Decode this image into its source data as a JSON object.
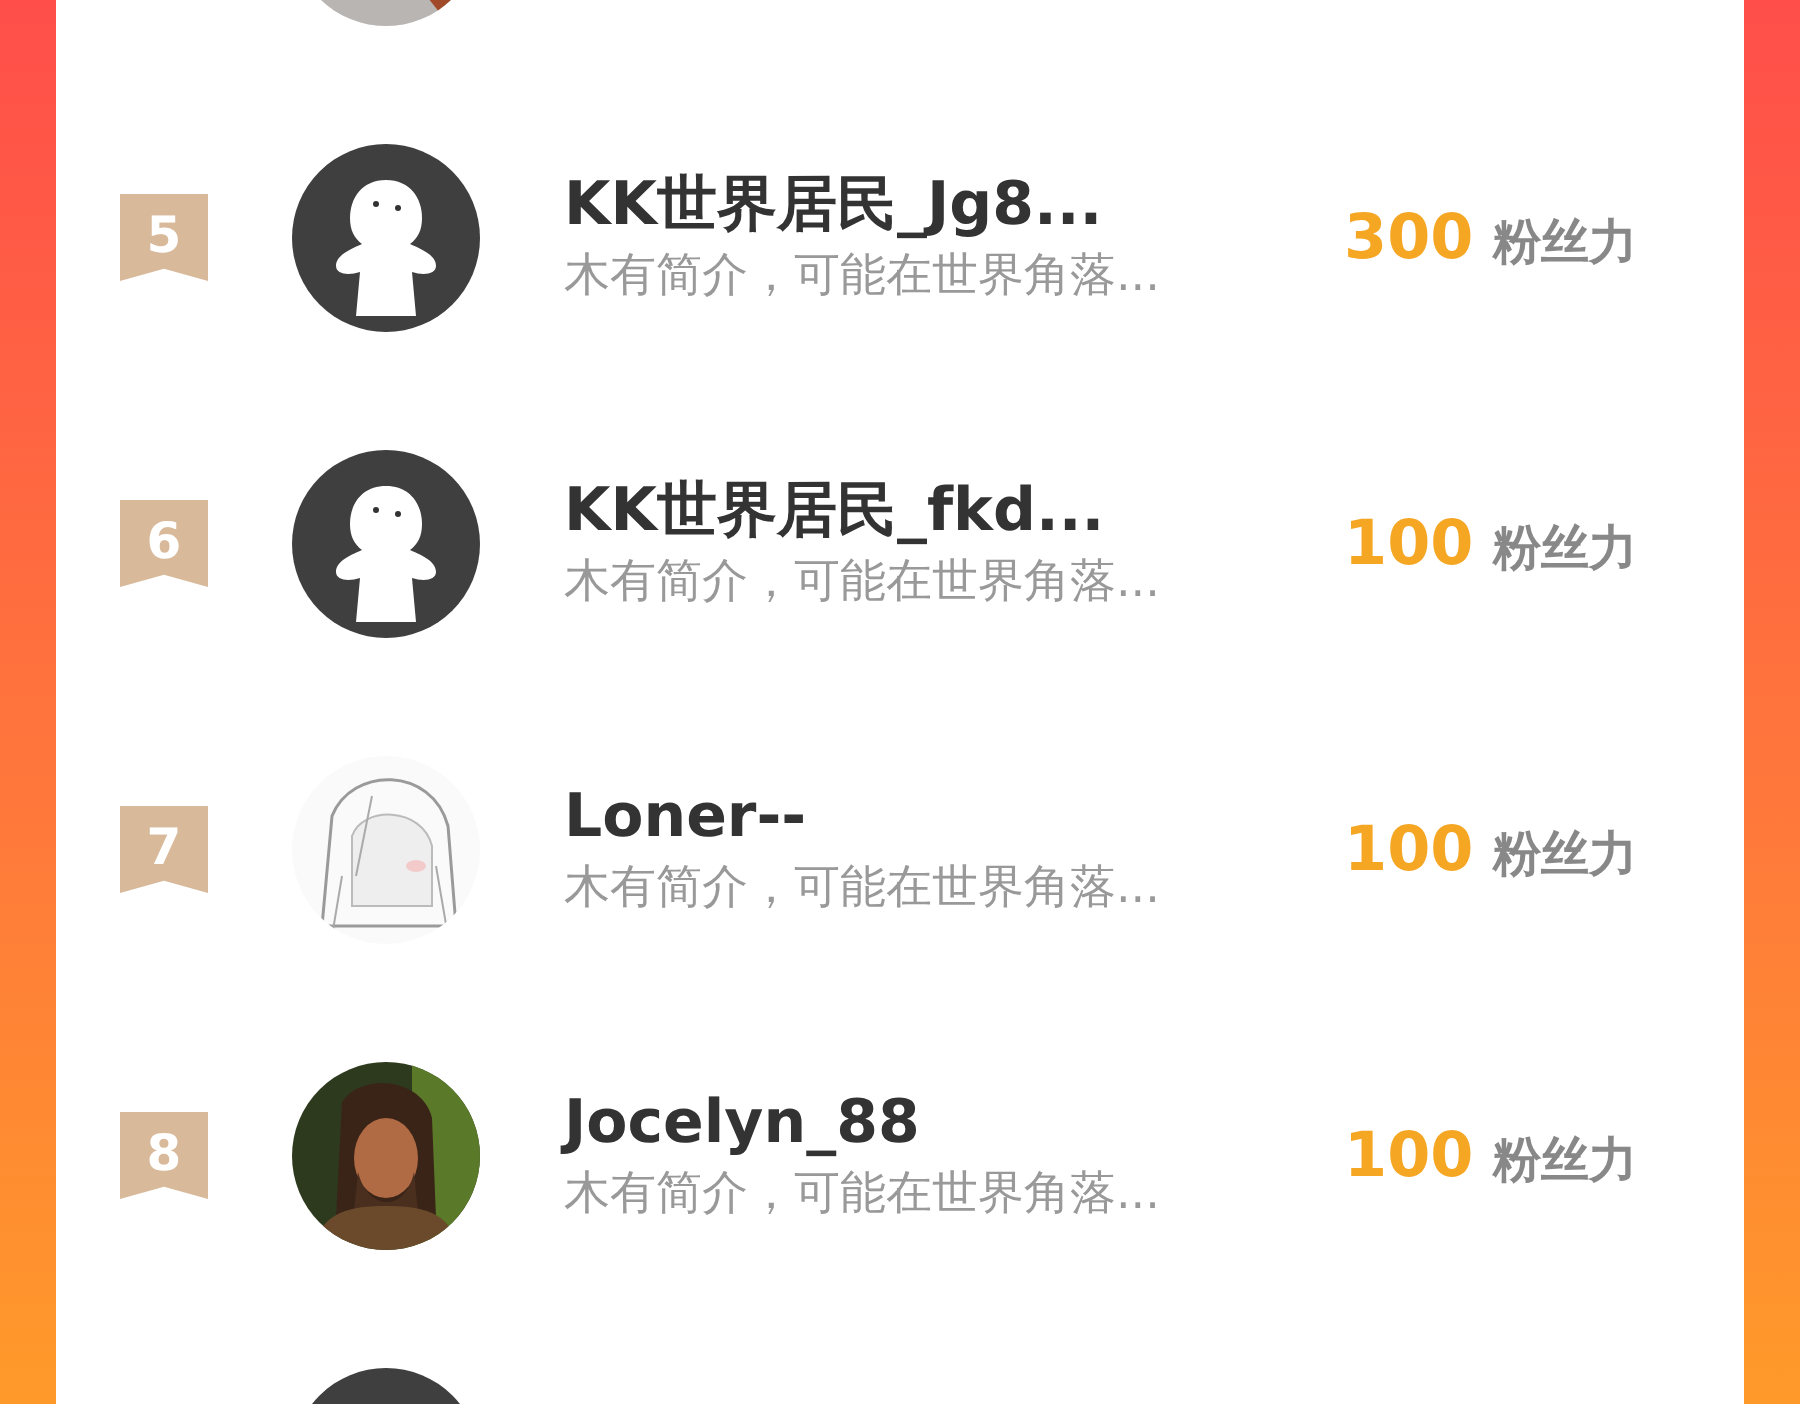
{
  "rows": [
    {
      "avatar": {
        "kind": "picture"
      }
    },
    {
      "rank": "5",
      "name": "KK世界居民_Jg8...",
      "bio": "木有简介，可能在世界角落...",
      "score": "300",
      "unit": "粉丝力",
      "avatar": {
        "kind": "default"
      }
    },
    {
      "rank": "6",
      "name": "KK世界居民_fkd...",
      "bio": "木有简介，可能在世界角落...",
      "score": "100",
      "unit": "粉丝力",
      "avatar": {
        "kind": "default"
      }
    },
    {
      "rank": "7",
      "name": "Loner--",
      "bio": "木有简介，可能在世界角落...",
      "score": "100",
      "unit": "粉丝力",
      "avatar": {
        "kind": "sketch"
      }
    },
    {
      "rank": "8",
      "name": "Jocelyn_88",
      "bio": "木有简介，可能在世界角落...",
      "score": "100",
      "unit": "粉丝力",
      "avatar": {
        "kind": "portrait"
      }
    },
    {
      "avatar": {
        "kind": "default"
      }
    }
  ]
}
